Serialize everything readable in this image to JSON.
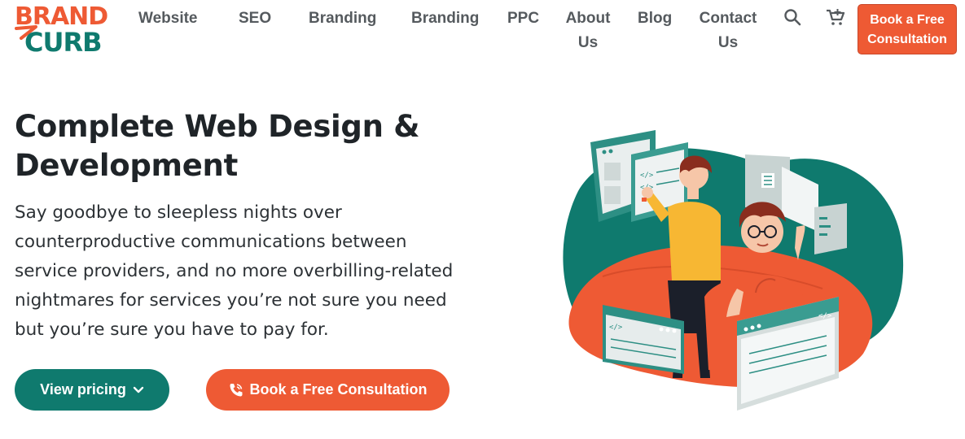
{
  "logo": {
    "line1": "BRAND",
    "line2": "CURB"
  },
  "nav": {
    "items": [
      "Website",
      "SEO",
      "Branding",
      "Branding",
      "PPC",
      "About Us",
      "Blog",
      "Contact Us"
    ],
    "icons": [
      "search-icon",
      "cart-icon"
    ],
    "cta": "Book a Free Consultation"
  },
  "hero": {
    "title": "Complete Web Design & Development",
    "body": "Say goodbye to sleepless nights over counterproductive communications between service providers, and no more overbilling-related nightmares for services you’re not sure you need but you’re sure you have to pay for.",
    "btn_pricing": "View pricing",
    "btn_consult": "Book a Free Consultation"
  },
  "colors": {
    "brand_orange": "#ee5a34",
    "brand_teal": "#0f7a6e",
    "shirt_yellow": "#f7b733"
  }
}
